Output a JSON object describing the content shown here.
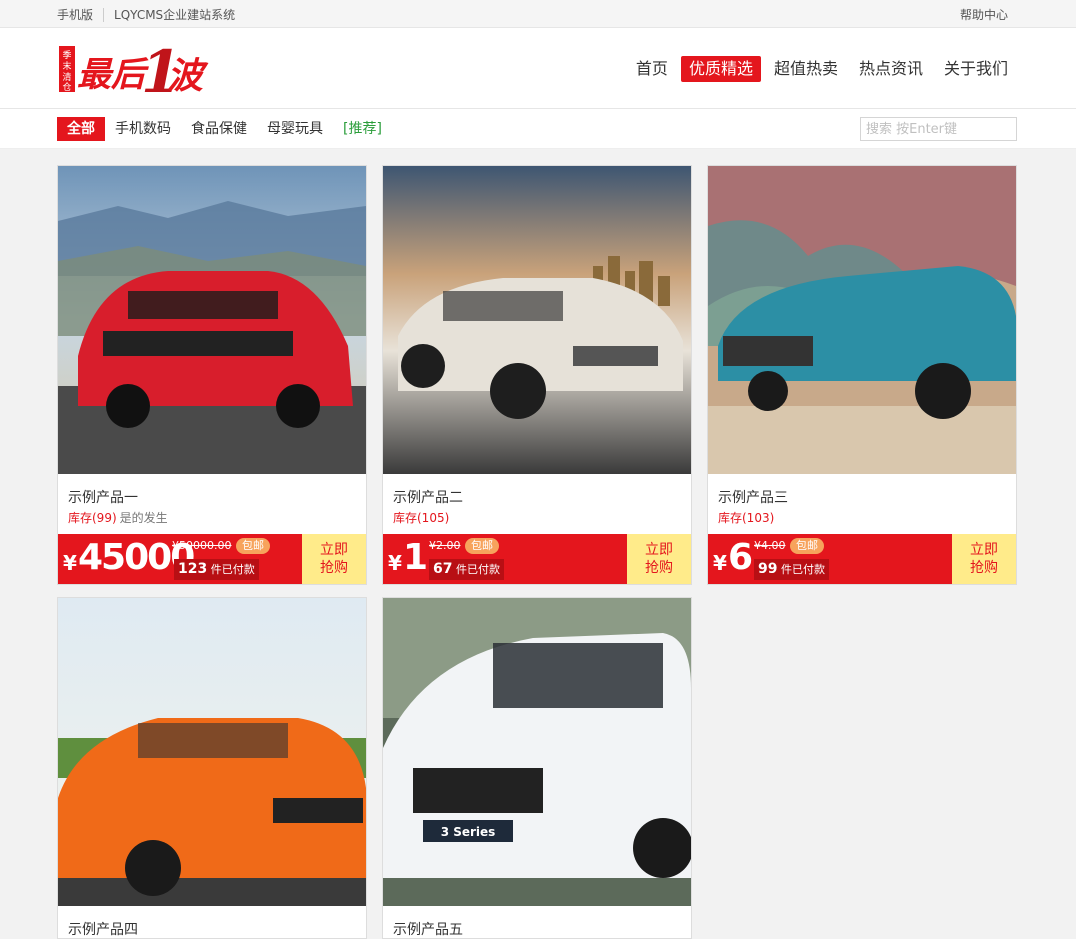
{
  "topbar": {
    "mobile": "手机版",
    "site": "LQYCMS企业建站系统",
    "help": "帮助中心"
  },
  "logo": {
    "seal": "季末清仓",
    "text": "最后",
    "one": "1",
    "wave": "波"
  },
  "nav": [
    {
      "label": "首页",
      "active": false
    },
    {
      "label": "优质精选",
      "active": true
    },
    {
      "label": "超值热卖",
      "active": false
    },
    {
      "label": "热点资讯",
      "active": false
    },
    {
      "label": "关于我们",
      "active": false
    }
  ],
  "categories": [
    {
      "label": "全部"
    },
    {
      "label": "手机数码"
    },
    {
      "label": "食品保健"
    },
    {
      "label": "母婴玩具"
    },
    {
      "label": "[推荐]"
    }
  ],
  "search": {
    "placeholder": "搜索 按Enter键"
  },
  "products": [
    {
      "name": "示例产品一",
      "stock_label": "库存(99)",
      "note": "是的发生",
      "price": "45000",
      "yuan": "¥",
      "old_price": "¥50000.00",
      "badge": "包邮",
      "sold_count": "123",
      "sold_label": "件已付款",
      "buy_line1": "立即",
      "buy_line2": "抢购",
      "image": "red-mustang-photo"
    },
    {
      "name": "示例产品二",
      "stock_label": "库存(105)",
      "note": "",
      "price": "1",
      "yuan": "¥",
      "old_price": "¥2.00",
      "badge": "包邮",
      "sold_count": "67",
      "sold_label": "件已付款",
      "buy_line1": "立即",
      "buy_line2": "抢购",
      "image": "white-concept-car-photo"
    },
    {
      "name": "示例产品三",
      "stock_label": "库存(103)",
      "note": "",
      "price": "6",
      "yuan": "¥",
      "old_price": "¥4.00",
      "badge": "包邮",
      "sold_count": "99",
      "sold_label": "件已付款",
      "buy_line1": "立即",
      "buy_line2": "抢购",
      "image": "blue-classic-mustang-graffiti-photo"
    },
    {
      "name": "示例产品四",
      "image": "orange-bmw-m3-photo"
    },
    {
      "name": "示例产品五",
      "image": "white-bmw-3series-photo"
    }
  ],
  "colors": {
    "brand_red": "#e4161d",
    "buy_yellow": "#ffeb8a",
    "badge_orange": "#f7a35c"
  }
}
